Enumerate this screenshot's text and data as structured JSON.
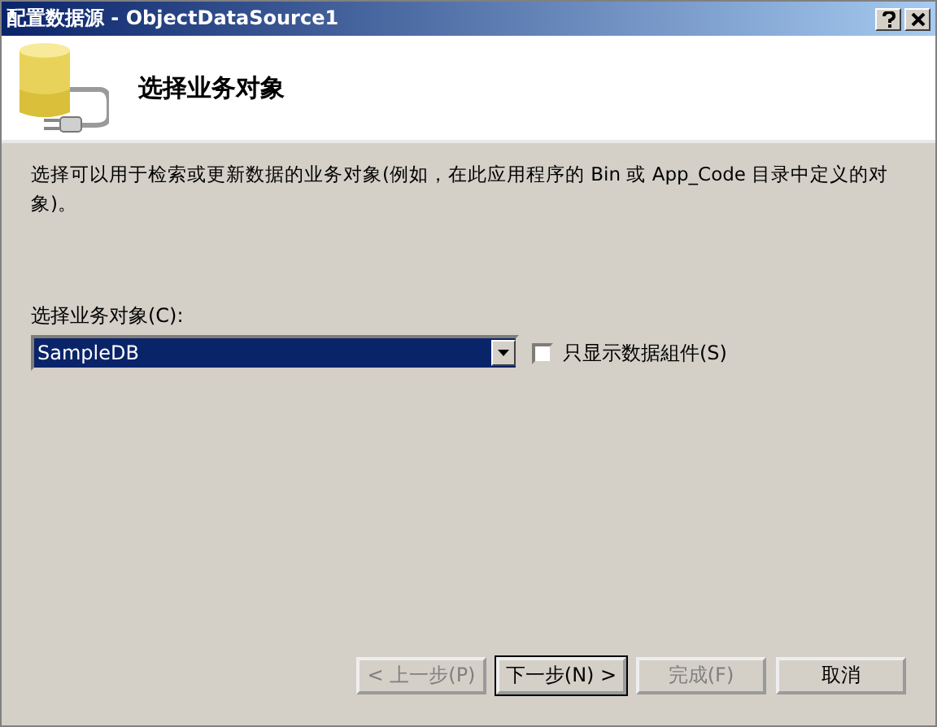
{
  "window": {
    "title": "配置数据源 - ObjectDataSource1"
  },
  "header": {
    "title": "选择业务对象"
  },
  "description": "选择可以用于检索或更新数据的业务对象(例如，在此应用程序的 Bin 或 App_Code 目录中定义的对象)。",
  "object_select": {
    "label": "选择业务对象(C):",
    "value": "SampleDB"
  },
  "data_components_only": {
    "label": "只显示数据組件(S)",
    "checked": false
  },
  "buttons": [
    {
      "label": "< 上一步(P)",
      "disabled": true,
      "default": false
    },
    {
      "label": "下一步(N) >",
      "disabled": false,
      "default": true
    },
    {
      "label": "完成(F)",
      "disabled": true,
      "default": false
    },
    {
      "label": "取消",
      "disabled": false,
      "default": false
    }
  ]
}
